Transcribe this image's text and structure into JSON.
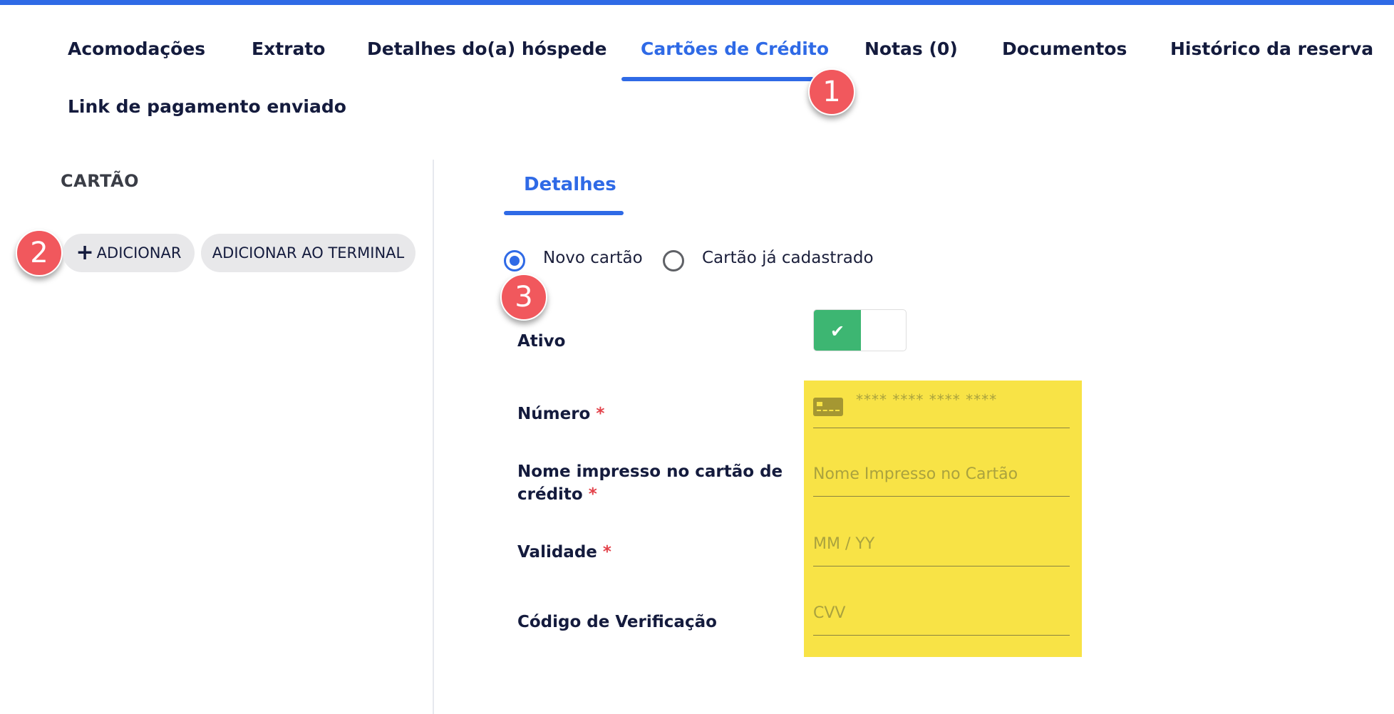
{
  "tabs": [
    {
      "label": "Acomodações",
      "active": false
    },
    {
      "label": "Extrato",
      "active": false
    },
    {
      "label": "Detalhes do(a) hóspede",
      "active": false
    },
    {
      "label": "Cartões de Crédito",
      "active": true
    },
    {
      "label": "Notas (0)",
      "active": false
    },
    {
      "label": "Documentos",
      "active": false
    },
    {
      "label": "Histórico da reserva",
      "active": false
    },
    {
      "label": "Link de pagamento enviado",
      "active": false
    }
  ],
  "annotations": [
    "1",
    "2",
    "3"
  ],
  "sidebar": {
    "title": "CARTÃO",
    "add_label": "ADICIONAR",
    "add_terminal_label": "ADICIONAR AO TERMINAL"
  },
  "detail": {
    "subtab": "Detalhes",
    "radio_new": "Novo cartão",
    "radio_existing": "Cartão já cadastrado",
    "selected_option": "Novo cartão",
    "active_label": "Ativo",
    "active_on": true,
    "number_label": "Número",
    "number_placeholder": "**** **** **** ****",
    "name_label_line1": "Nome impresso no cartão de",
    "name_label_line2": "crédito",
    "name_placeholder": "Nome Impresso no Cartão",
    "validity_label": "Validade",
    "validity_placeholder": "MM / YY",
    "cvv_label": "Código de Verificação",
    "cvv_placeholder": "CVV",
    "required_mark": "*"
  },
  "colors": {
    "accent": "#2f6ae6",
    "badge": "#f1585d",
    "highlight": "#f8e346",
    "toggle_on": "#3db672",
    "required": "#e3424a"
  },
  "icons": [
    "plus-icon",
    "check-icon",
    "credit-card-icon"
  ]
}
